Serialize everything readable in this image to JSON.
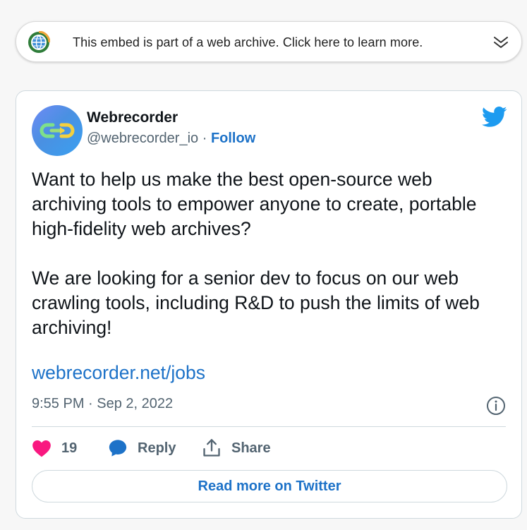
{
  "banner": {
    "text": "This embed is part of a web archive. Click here to learn more.",
    "icon": "webrecorder-globe-icon",
    "chevron": "double-chevron-down-icon"
  },
  "tweet": {
    "author_name": "Webrecorder",
    "handle": "@webrecorder_io",
    "separator": " · ",
    "follow_label": "Follow",
    "paragraphs": [
      "Want to help us make the best open-source web archiving tools to empower anyone to create, portable high-fidelity web archives?",
      "We are looking for a senior dev to focus on our web crawling tools, including R&D to push the limits of web archiving!"
    ],
    "link_text": "webrecorder.net/jobs",
    "timestamp": "9:55 PM · Sep 2, 2022",
    "like_count": "19",
    "reply_label": "Reply",
    "share_label": "Share",
    "read_more_label": "Read more on Twitter"
  },
  "colors": {
    "accent_blue": "#1d72c8",
    "twitter_blue": "#1d9bf0",
    "like_pink": "#f91880",
    "text_primary": "#0f1419",
    "text_secondary": "#536471",
    "border": "#cfd9de"
  }
}
